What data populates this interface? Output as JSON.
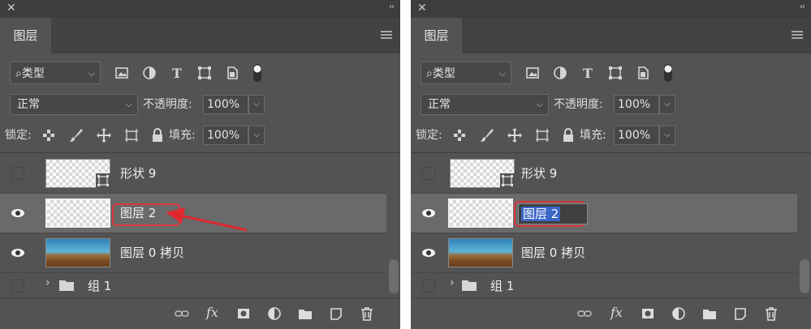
{
  "panels": [
    {
      "id": "left",
      "tab_label": "图层",
      "filter_kind_label": "类型",
      "blend_mode": "正常",
      "opacity_label": "不透明度:",
      "opacity_value": "100%",
      "lock_label": "锁定:",
      "fill_label": "填充:",
      "fill_value": "100%",
      "layers": [
        {
          "name": "形状 9",
          "visible": false
        },
        {
          "name": "图层 2",
          "visible": true,
          "selected": true
        },
        {
          "name": "图层 0 拷贝",
          "visible": true
        }
      ],
      "group": {
        "name": "组 1",
        "visible": false
      },
      "bottom_fx_label": "fx"
    },
    {
      "id": "right",
      "tab_label": "图层",
      "filter_kind_label": "类型",
      "blend_mode": "正常",
      "opacity_label": "不透明度:",
      "opacity_value": "100%",
      "lock_label": "锁定:",
      "fill_label": "填充:",
      "fill_value": "100%",
      "layers": [
        {
          "name": "形状 9",
          "visible": false
        },
        {
          "name": "图层 2",
          "visible": true,
          "selected": true,
          "renaming": true
        },
        {
          "name": "图层 0 拷贝",
          "visible": true
        }
      ],
      "group": {
        "name": "组 1",
        "visible": false
      },
      "bottom_fx_label": "fx"
    }
  ],
  "colors": {
    "panel_bg": "#535353",
    "selected_row": "#6a6a6a",
    "highlight_red": "#d9363e",
    "text_selection": "#3a66c6"
  }
}
